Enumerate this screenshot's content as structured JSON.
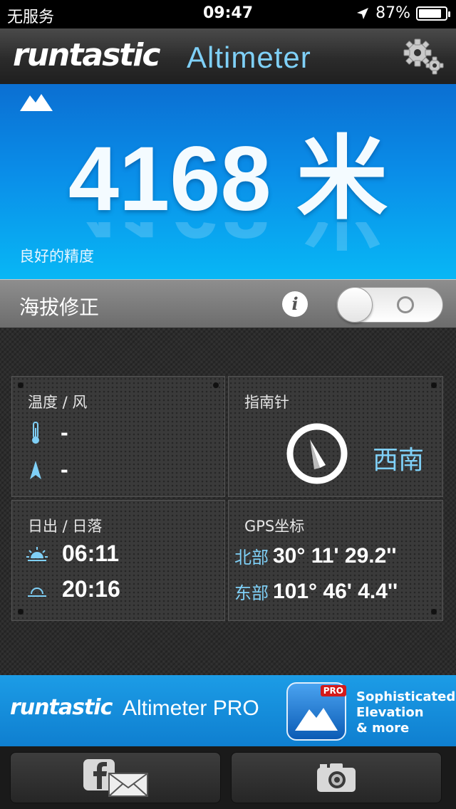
{
  "status_bar": {
    "carrier": "无服务",
    "time": "09:47",
    "battery_percent": "87%",
    "battery_level": 0.87,
    "location_icon": "location-arrow-icon"
  },
  "header": {
    "brand": "runtastic",
    "app_name": "Altimeter",
    "settings_icon": "gear-icon"
  },
  "altitude": {
    "value": "4168 米",
    "accuracy": "良好的精度",
    "icon": "mountain-icon",
    "color": "#0a8de8"
  },
  "calibration": {
    "label": "海拔修正",
    "info_icon": "info-icon",
    "toggle_on": false
  },
  "panels": {
    "weather": {
      "title": "温度 / 风",
      "temperature": "-",
      "wind": "-",
      "temperature_icon": "thermometer-icon",
      "wind_icon": "wind-arrow-icon"
    },
    "compass": {
      "title": "指南针",
      "direction": "西南",
      "icon": "compass-icon"
    },
    "sun": {
      "title": "日出 / 日落",
      "sunrise": "06:11",
      "sunset": "20:16",
      "sunrise_icon": "sunrise-icon",
      "sunset_icon": "sunset-icon"
    },
    "gps": {
      "title": "GPS坐标",
      "lat_label": "北部",
      "lat_value": "30° 11' 29.2''",
      "lon_label": "东部",
      "lon_value": "101° 46' 4.4''"
    }
  },
  "ad": {
    "brand": "runtastic",
    "product": "Altimeter PRO",
    "badge": "PRO",
    "tagline_1": "Sophisticated",
    "tagline_2": "Elevation",
    "tagline_3": "& more"
  },
  "toolbar": {
    "share_icon": "facebook-mail-icon",
    "camera_icon": "camera-icon"
  },
  "colors": {
    "accent_blue": "#7fd0f7",
    "hero_blue": "#0a8de8"
  }
}
